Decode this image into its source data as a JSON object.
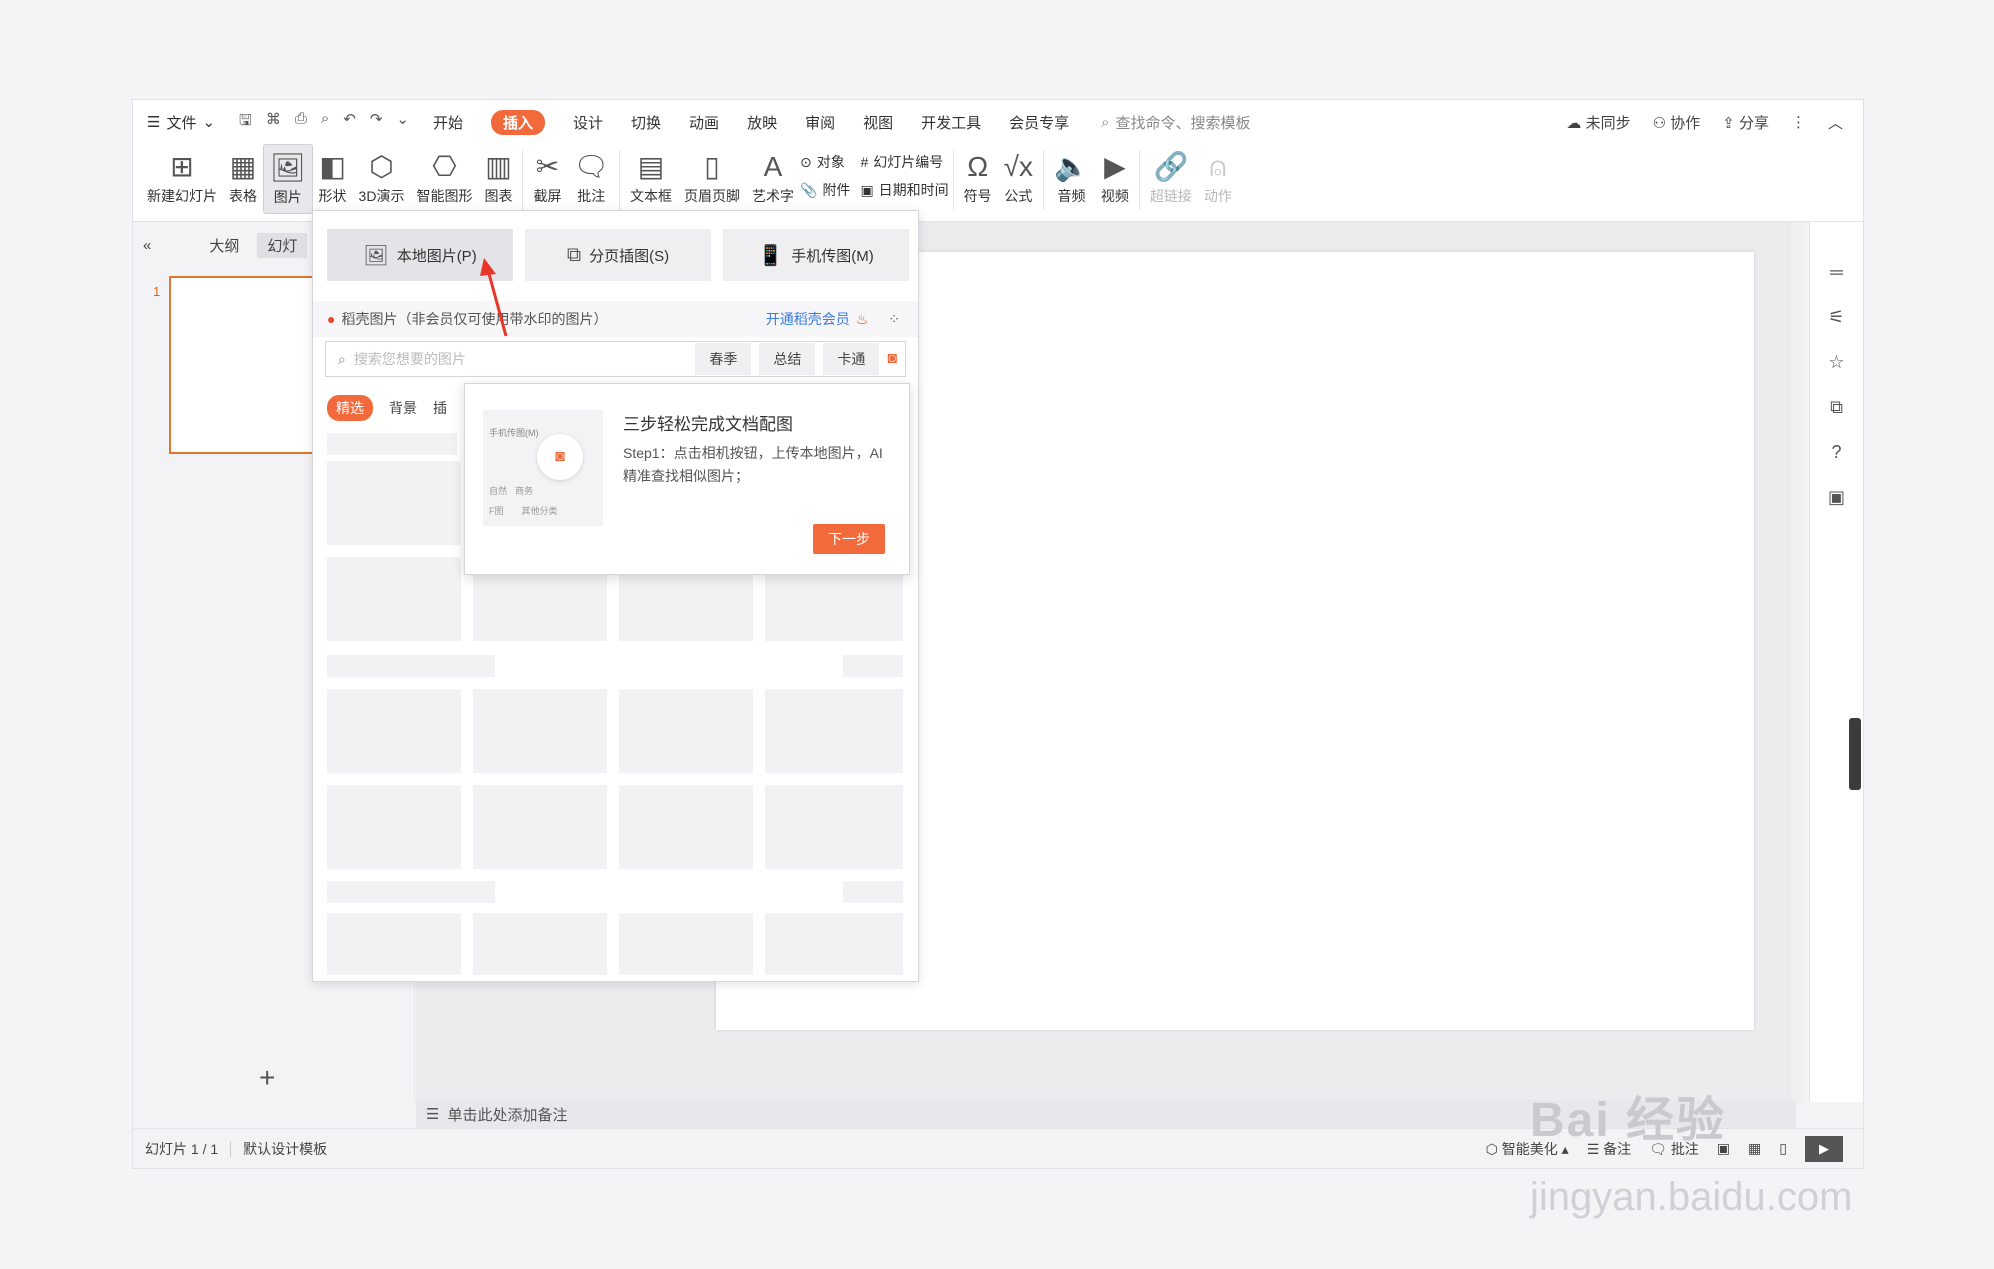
{
  "menu": {
    "file": "文件",
    "tabs": [
      "开始",
      "插入",
      "设计",
      "切换",
      "动画",
      "放映",
      "审阅",
      "视图",
      "开发工具",
      "会员专享"
    ],
    "active_tab": "插入",
    "search": "查找命令、搜索模板",
    "right": [
      "未同步",
      "协作",
      "分享"
    ]
  },
  "ribbon": {
    "new_slide": "新建幻灯片",
    "table": "表格",
    "picture": "图片",
    "shape": "形状",
    "demo3d": "3D演示",
    "smart": "智能图形",
    "chart": "图表",
    "screenshot": "截屏",
    "comment": "批注",
    "textbox": "文本框",
    "header_footer": "页眉页脚",
    "wordart": "艺术字",
    "object": "对象",
    "slide_no": "幻灯片编号",
    "attach": "附件",
    "datetime": "日期和时间",
    "symbol": "符号",
    "formula": "公式",
    "audio": "音频",
    "video": "视频",
    "hyperlink": "超链接",
    "action": "动作"
  },
  "left": {
    "tab1": "大纲",
    "tab2": "幻灯",
    "slide_no": "1"
  },
  "dropdown": {
    "btn_local": "本地图片(P)",
    "btn_page": "分页插图(S)",
    "btn_phone": "手机传图(M)",
    "promo": "稻壳图片（非会员仅可使用带水印的图片）",
    "promo_link": "开通稻壳会员",
    "search_placeholder": "搜索您想要的图片",
    "tags": [
      "春季",
      "总结",
      "卡通"
    ],
    "cats": [
      "精选",
      "背景",
      "插"
    ]
  },
  "tip": {
    "title": "三步轻松完成文档配图",
    "text": "Step1：点击相机按钮，上传本地图片，AI精准查找相似图片；",
    "next": "下一步",
    "img_label1": "手机传图(M)",
    "img_label2": "自然",
    "img_label3": "商务",
    "img_label4": "F图",
    "img_label5": "其他分类"
  },
  "notes": "单击此处添加备注",
  "status": {
    "slide": "幻灯片 1 / 1",
    "template": "默认设计模板",
    "beautify": "智能美化",
    "notes": "备注",
    "comment": "批注"
  },
  "watermark": {
    "logo": "Bai 经验",
    "url": "jingyan.baidu.com"
  }
}
